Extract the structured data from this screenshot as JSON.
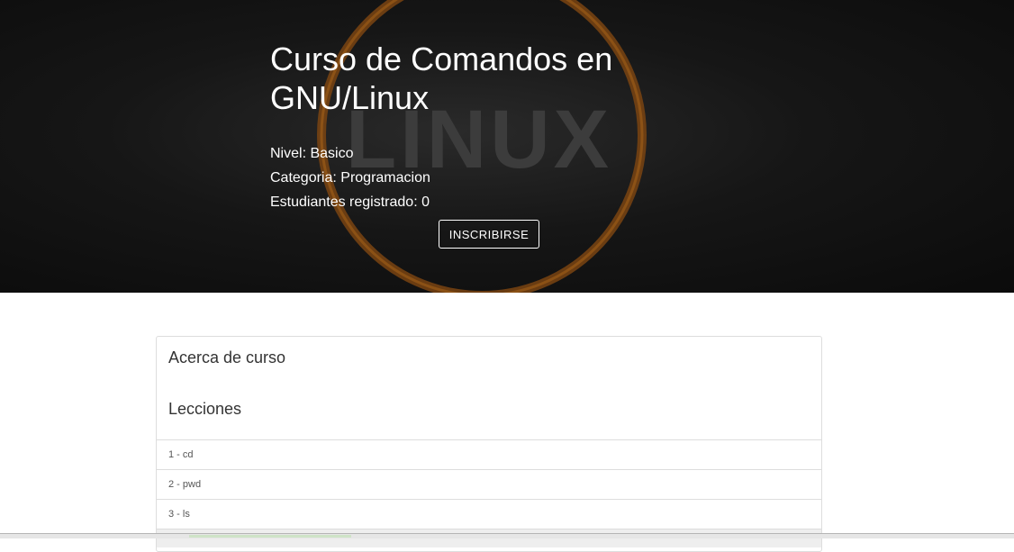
{
  "hero": {
    "title": "Curso de Comandos en GNU/Linux",
    "level": "Nivel: Basico",
    "category": "Categoria: Programacion",
    "students": "Estudiantes registrado: 0",
    "enroll_label": "INSCRIBIRSE",
    "background_logo_text": "LINUX",
    "accent_color": "#c8781e"
  },
  "panel": {
    "about_heading": "Acerca de curso",
    "lessons_heading": "Lecciones",
    "lessons": [
      {
        "label": "1 - cd"
      },
      {
        "label": "2 - pwd"
      },
      {
        "label": "3 - ls"
      }
    ]
  }
}
